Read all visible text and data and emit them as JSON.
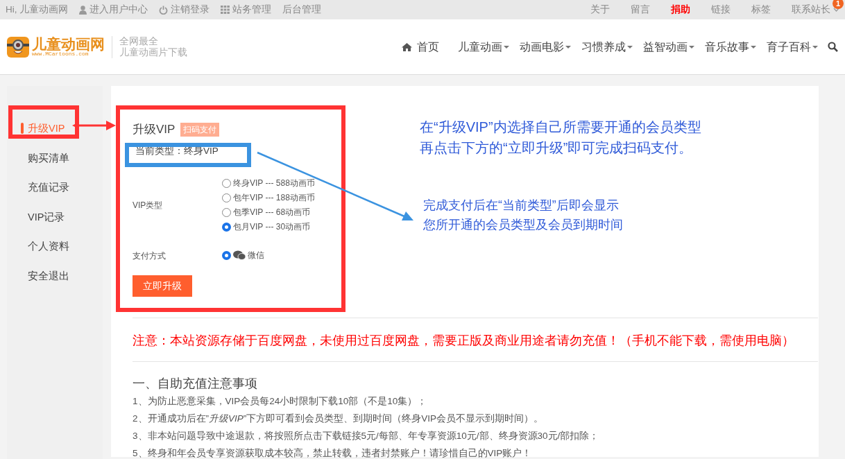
{
  "top_bar": {
    "greeting": "Hi, 儿童动画网",
    "left_links": [
      {
        "label": "进入用户中心",
        "kind": "user"
      },
      {
        "label": "注销登录",
        "kind": "power"
      },
      {
        "label": "站务管理",
        "kind": "grid"
      },
      {
        "label": "后台管理",
        "kind": "plain"
      }
    ],
    "right_links": [
      {
        "label": "关于",
        "highlighted": false
      },
      {
        "label": "留言",
        "highlighted": false
      },
      {
        "label": "捐助",
        "highlighted": true
      },
      {
        "label": "链接",
        "highlighted": false
      },
      {
        "label": "标签",
        "highlighted": false
      },
      {
        "label": "联系站长",
        "highlighted": false
      }
    ],
    "badge": "1"
  },
  "header": {
    "logo_name": "儿童动画网",
    "logo_url": "www.MCartoons.com",
    "slogan": [
      "全网最全",
      "儿童动画片下载"
    ],
    "nav": [
      {
        "label": "首页",
        "kind": "home"
      },
      {
        "label": "儿童动画",
        "kind": "dropdown"
      },
      {
        "label": "动画电影",
        "kind": "dropdown"
      },
      {
        "label": "习惯养成",
        "kind": "dropdown"
      },
      {
        "label": "益智动画",
        "kind": "dropdown"
      },
      {
        "label": "音乐故事",
        "kind": "dropdown"
      },
      {
        "label": "育子百科",
        "kind": "dropdown"
      }
    ]
  },
  "sidebar": {
    "items": [
      {
        "label": "升级VIP",
        "selected": true
      },
      {
        "label": "购买清单",
        "selected": false
      },
      {
        "label": "充值记录",
        "selected": false
      },
      {
        "label": "VIP记录",
        "selected": false
      },
      {
        "label": "个人资料",
        "selected": false
      },
      {
        "label": "安全退出",
        "selected": false
      }
    ]
  },
  "panel": {
    "title": "升级VIP",
    "tag": "扫码支付",
    "current_type": "当前类型：终身VIP",
    "vip_label": "VIP类型",
    "vip_options": [
      {
        "label": "终身VIP --- 588动画币",
        "selected": false
      },
      {
        "label": "包年VIP --- 188动画币",
        "selected": false
      },
      {
        "label": "包季VIP --- 68动画币",
        "selected": false
      },
      {
        "label": "包月VIP --- 30动画币",
        "selected": true
      }
    ],
    "pay_label": "支付方式",
    "pay_options": [
      {
        "label": "微信",
        "selected": true
      }
    ],
    "submit": "立即升级"
  },
  "notice": "注意：本站资源存储于百度网盘，未使用过百度网盘，需要正版及商业用途者请勿充值！（手机不能下载，需使用电脑）",
  "notes": {
    "title": "一、自助充值注意事项",
    "items": [
      "1、为防止恶意采集，VIP会员每24小时限制下载10部（不是10集）；",
      "2、开通成功后在”*升级VIP*”下方即可看到会员类型、到期时间（终身VIP会员不显示到期时间）。",
      "3、非本站问题导致中途退款，将按照所点击下载链接5元/每部、年专享资源10元/部、终身资源30元/部扣除；",
      "5、终身和年会员专享资源获取成本较高，禁止转载，违者封禁账户！请珍惜自己的VIP账户！"
    ]
  },
  "annotations": {
    "top_note": [
      "在“升级VIP”内选择自己所需要开通的会员类型",
      "再点击下方的“立即升级”即可完成扫码支付。"
    ],
    "arrow_note": [
      "完成支付后在“当前类型”后即会显示",
      "您所开通的会员类型及会员到期时间"
    ]
  }
}
